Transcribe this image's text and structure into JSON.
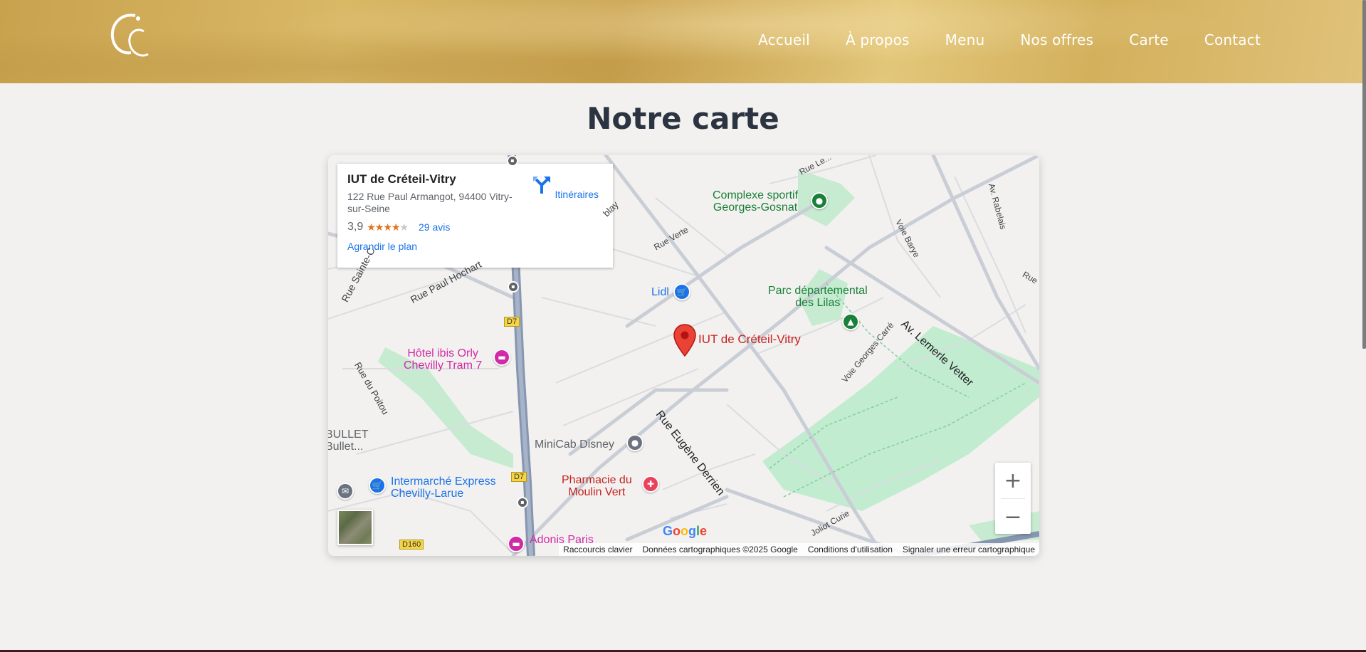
{
  "nav": {
    "items": [
      "Accueil",
      "À propos",
      "Menu",
      "Nos offres",
      "Carte",
      "Contact"
    ]
  },
  "page": {
    "title": "Notre carte"
  },
  "map": {
    "place": {
      "name": "IUT de Créteil-Vitry",
      "address": "122 Rue Paul Armangot, 94400 Vitry-sur-Seine",
      "rating": "3,9",
      "stars_filled": 4,
      "reviews": "29 avis",
      "enlarge": "Agrandir le plan",
      "directions": "Itinéraires"
    },
    "marker_label": "IUT de Créteil-Vitry",
    "pois": {
      "complexe": "Complexe sportif\nGeorges-Gosnat",
      "parc": "Parc départemental\ndes Lilas",
      "lidl": "Lidl",
      "ibis": "Hôtel ibis Orly\nChevilly Tram 7",
      "minicab": "MiniCab Disney",
      "intermarche": "Intermarché Express\nChevilly-Larue",
      "pharmacie": "Pharmacie du\nMoulin Vert",
      "adonis": "Adonis Paris",
      "bullet": "BULLET\nBullet..."
    },
    "streets": {
      "paul_hochart": "Rue Paul Hochart",
      "sainte": "Rue Sainte-C",
      "poitou": "Rue du Poitou",
      "verte": "Rue Verte",
      "eugene": "Rue Eugène Derrien",
      "lemerle": "Av. Lemerle Vetter",
      "georges_carre": "Voie Georges Carré",
      "barye": "Voie Barye",
      "rabelais": "Av. Rabelais",
      "rue_le": "Rue Le...",
      "rue": "Rue",
      "blay": "blay",
      "joliot": "Joliot Curie"
    },
    "shields": {
      "d7": "D7",
      "d160": "D160"
    },
    "footer": {
      "shortcuts": "Raccourcis clavier",
      "data": "Données cartographiques ©2025 Google",
      "terms": "Conditions d'utilisation",
      "report": "Signaler une erreur cartographique"
    },
    "google": "Google",
    "zoom_in": "+",
    "zoom_out": "−"
  },
  "colors": {
    "header": "#d4b35f",
    "title": "#2b3440",
    "link": "#1a73e8",
    "marker": "#ea4335"
  }
}
